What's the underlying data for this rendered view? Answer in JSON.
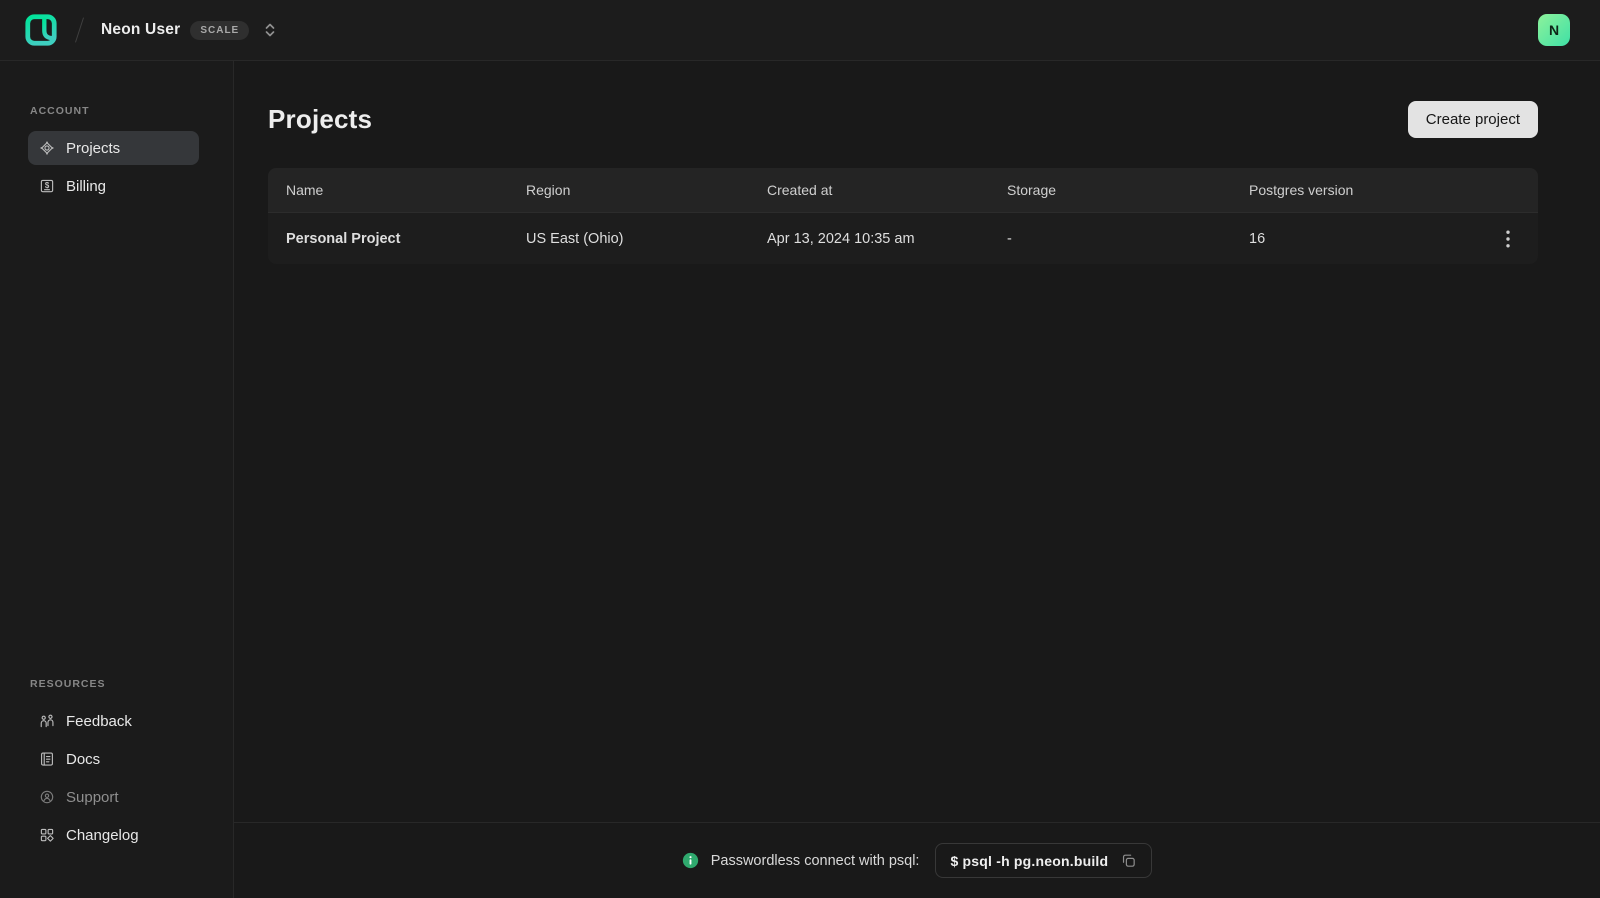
{
  "topbar": {
    "org_name": "Neon User",
    "plan_badge": "SCALE",
    "avatar_letter": "N",
    "logo_icon": "neon-logo-icon",
    "switcher_icon": "chevron-up-down-icon"
  },
  "sidebar": {
    "sections": [
      {
        "label": "ACCOUNT",
        "items": [
          {
            "label": "Projects",
            "icon": "projects-icon",
            "active": true
          },
          {
            "label": "Billing",
            "icon": "billing-icon",
            "active": false
          }
        ]
      },
      {
        "label": "RESOURCES",
        "items": [
          {
            "label": "Feedback",
            "icon": "feedback-icon"
          },
          {
            "label": "Docs",
            "icon": "docs-icon"
          },
          {
            "label": "Support",
            "icon": "support-icon",
            "dimmed": true
          },
          {
            "label": "Changelog",
            "icon": "changelog-icon"
          }
        ]
      }
    ]
  },
  "main": {
    "title": "Projects",
    "create_button_label": "Create project",
    "table": {
      "headers": [
        "Name",
        "Region",
        "Created at",
        "Storage",
        "Postgres version"
      ],
      "rows": [
        {
          "name": "Personal Project",
          "region": "US East (Ohio)",
          "created_at": "Apr 13, 2024 10:35 am",
          "storage": "-",
          "postgres_version": "16"
        }
      ]
    }
  },
  "footer": {
    "message": "Passwordless connect with psql:",
    "command": "$ psql -h pg.neon.build",
    "info_icon": "info-icon",
    "copy_icon": "copy-icon"
  },
  "colors": {
    "brand_green": "#00e599",
    "info_green": "#2fa96e",
    "topbar_bg": "#1c1c1c",
    "page_bg": "#191919",
    "table_header_bg": "#242424",
    "row_bg": "#1d1d1d",
    "active_item_bg": "#35373a",
    "button_bg": "#e3e3e3"
  }
}
